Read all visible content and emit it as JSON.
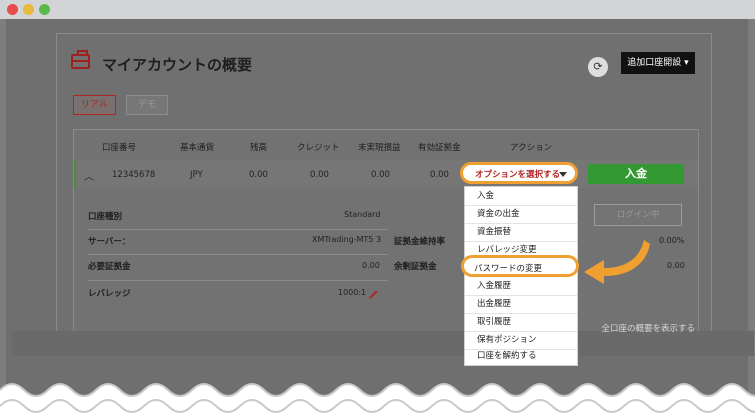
{
  "page_title": "マイアカウントの概要",
  "header": {
    "refresh_icon": "refresh-icon",
    "add_account_label": "追加口座開設 ▾"
  },
  "tabs": [
    {
      "label": "リアル",
      "active": true
    },
    {
      "label": "デモ",
      "active": false
    }
  ],
  "table": {
    "headers": [
      "口座番号",
      "基本通貨",
      "残高",
      "クレジット",
      "未実現損益",
      "有効証拠金",
      "アクション"
    ],
    "row": {
      "account_number": "12345678",
      "currency": "JPY",
      "balance": "0.00",
      "credit": "0.00",
      "unrealized": "0.00",
      "equity": "0.00"
    }
  },
  "details": {
    "account_type_label": "口座種別",
    "account_type_value": "Standard",
    "server_label": "サーバー：",
    "server_value": "XMTrading-MT5 3",
    "required_margin_label": "必要証拠金",
    "required_margin_value": "0.00",
    "leverage_label": "レバレッジ",
    "leverage_value": "1000:1",
    "margin_level_label": "証拠金維持率",
    "margin_level_value": "0.00%",
    "free_margin_label": "余剰証拠金",
    "free_margin_value": "0.00"
  },
  "actions": {
    "select_label": "オプションを選択する",
    "deposit_label": "入金",
    "login_label": "ログイン中"
  },
  "menu_items": [
    "入金",
    "資金の出金",
    "資金振替",
    "レバレッジ変更",
    "パスワードの変更",
    "入金履歴",
    "出金履歴",
    "取引履歴",
    "保有ポジション",
    "口座を解約する"
  ],
  "footer_link": "全口座の概要を表示する",
  "colors": {
    "accent_red": "#b02424",
    "highlight_orange": "#f0a030",
    "deposit_green": "#339a33"
  }
}
